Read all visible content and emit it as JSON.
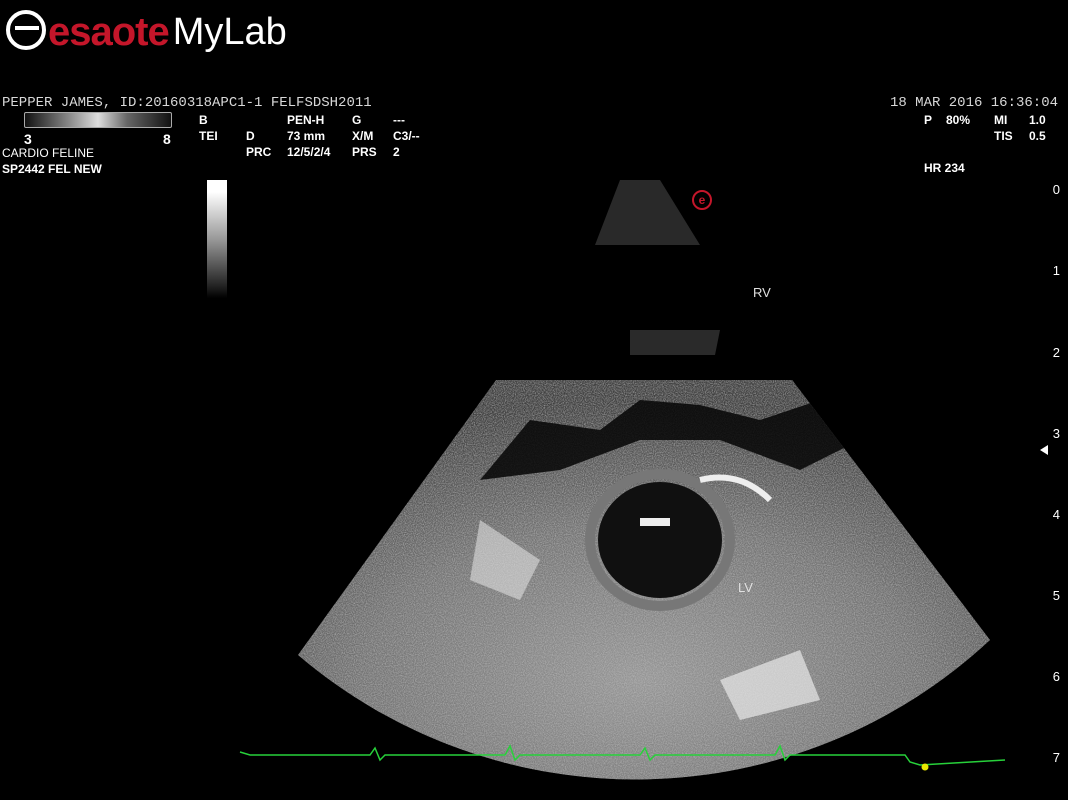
{
  "brand": {
    "name_part1": "esaote",
    "name_part2": "MyLab"
  },
  "header": {
    "patient_line": "PEPPER JAMES, ID:20160318APC1-1  FELFSDSH2011",
    "datetime": "18  MAR  2016 16:36:04"
  },
  "scale": {
    "min": "3",
    "max": "8"
  },
  "exam": {
    "line1": "CARDIO FELINE",
    "line2": "SP2442  FEL NEW"
  },
  "params": {
    "c1": [
      "B",
      "TEI"
    ],
    "c2": [
      "",
      "D",
      "PRC"
    ],
    "c3": [
      "PEN-H",
      "73 mm",
      "12/5/2/4"
    ],
    "c4": [
      "G",
      "X/M",
      "PRS"
    ],
    "c5": [
      "---",
      "C3/--",
      "2"
    ]
  },
  "right_params": {
    "p_label": "P",
    "p_value": "80%",
    "mi_label": "MI",
    "mi_value": "1.0",
    "tis_label": "TIS",
    "tis_value": "0.5",
    "hr": "HR 234"
  },
  "depth_marks": [
    "0",
    "1",
    "2",
    "3",
    "4",
    "5",
    "6",
    "7"
  ],
  "anatomy": {
    "rv": "RV",
    "lv": "LV"
  },
  "probe_marker": "e"
}
